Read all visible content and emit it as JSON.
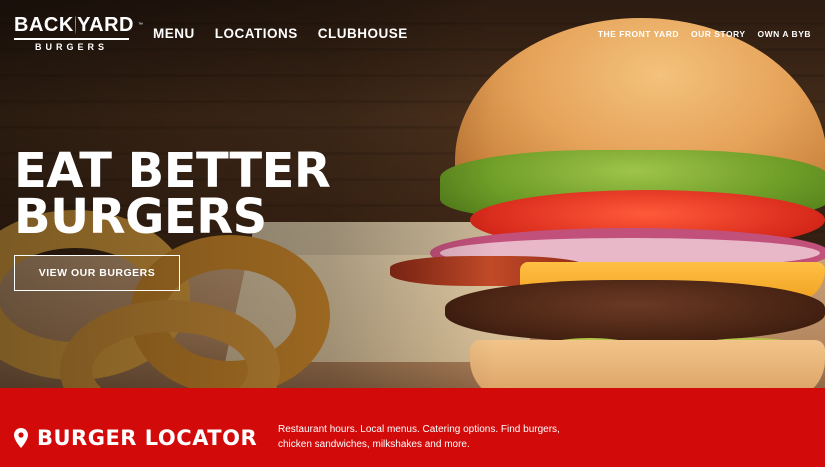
{
  "brand": {
    "logo_top_left": "BACK",
    "logo_top_right": "YARD",
    "logo_bottom": "BURGERS",
    "logo_tm": "™"
  },
  "nav": {
    "main": [
      {
        "label": "MENU"
      },
      {
        "label": "LOCATIONS"
      },
      {
        "label": "CLUBHOUSE"
      }
    ],
    "secondary": [
      {
        "label": "THE FRONT YARD"
      },
      {
        "label": "OUR STORY"
      },
      {
        "label": "OWN A BYB"
      }
    ]
  },
  "hero": {
    "headline_line1": "EAT BETTER",
    "headline_line2": "BURGERS",
    "cta_label": "VIEW OUR BURGERS"
  },
  "locator": {
    "title": "BURGER LOCATOR",
    "description": "Restaurant hours. Local menus. Catering options. Find burgers, chicken sandwiches, milkshakes and more.",
    "icon": "map-pin-icon"
  },
  "colors": {
    "accent_red": "#d20a0a",
    "text_white": "#ffffff"
  }
}
